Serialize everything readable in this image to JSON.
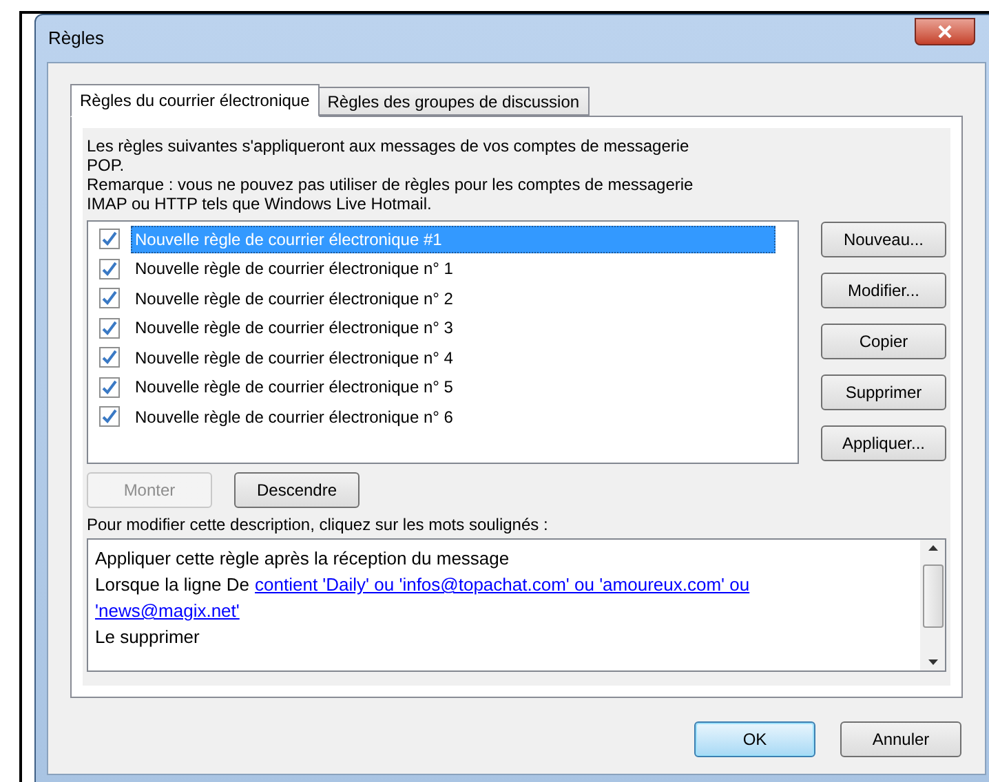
{
  "window": {
    "title": "Règles"
  },
  "tabs": [
    {
      "label": "Règles du courrier électronique",
      "selected": true
    },
    {
      "label": "Règles des groupes de discussion",
      "selected": false
    }
  ],
  "intro": [
    "Les règles suivantes s'appliqueront aux messages de vos comptes de messagerie POP.",
    "Remarque : vous ne pouvez pas utiliser de règles pour les comptes de messagerie IMAP ou HTTP tels que Windows Live Hotmail."
  ],
  "rules": [
    {
      "name": "Nouvelle règle de courrier électronique #1",
      "checked": true,
      "selected": true
    },
    {
      "name": "Nouvelle règle de courrier électronique n° 1",
      "checked": true,
      "selected": false
    },
    {
      "name": "Nouvelle règle de courrier électronique n° 2",
      "checked": true,
      "selected": false
    },
    {
      "name": "Nouvelle règle de courrier électronique n° 3",
      "checked": true,
      "selected": false
    },
    {
      "name": "Nouvelle règle de courrier électronique n° 4",
      "checked": true,
      "selected": false
    },
    {
      "name": "Nouvelle règle de courrier électronique n° 5",
      "checked": true,
      "selected": false
    },
    {
      "name": "Nouvelle règle de courrier électronique n° 6",
      "checked": true,
      "selected": false
    }
  ],
  "side_buttons": [
    {
      "label": "Nouveau..."
    },
    {
      "label": "Modifier..."
    },
    {
      "label": "Copier"
    },
    {
      "label": "Supprimer"
    },
    {
      "label": "Appliquer..."
    }
  ],
  "move_buttons": [
    {
      "label": "Monter",
      "disabled": true
    },
    {
      "label": "Descendre",
      "disabled": false
    }
  ],
  "description_label": "Pour modifier cette description, cliquez sur les mots soulignés :",
  "description": [
    {
      "kind": "text",
      "text": "Appliquer cette règle après la réception du message"
    },
    {
      "kind": "condition",
      "text": "Lorsque la ligne De",
      "link_lines": [
        "contient 'Daily' ou 'infos@topachat.com' ou 'amoureux.com' ou",
        "'news@magix.net'"
      ]
    },
    {
      "kind": "text",
      "text": "Le supprimer"
    }
  ],
  "footer_buttons": [
    {
      "label": "OK",
      "default": true
    },
    {
      "label": "Annuler",
      "default": false
    }
  ]
}
